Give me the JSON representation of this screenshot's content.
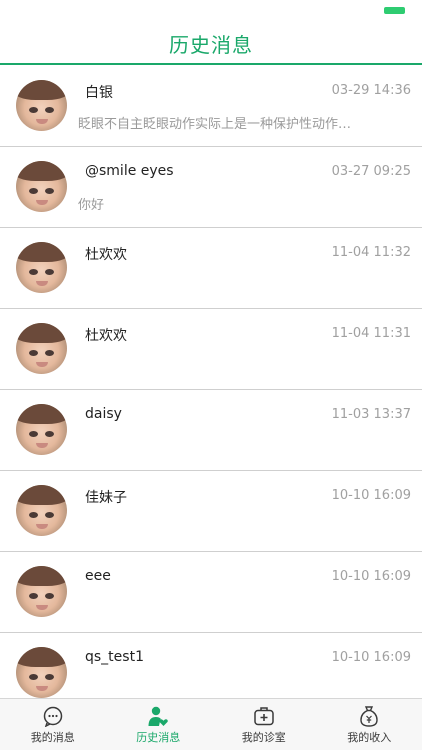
{
  "colors": {
    "accent": "#1aa86a",
    "battery": "#2ecc71",
    "tab_inactive": "#3a3a3a",
    "tab_active": "#1aa86a"
  },
  "header": {
    "title": "历史消息"
  },
  "messages": [
    {
      "name": "白银",
      "time": "03-29 14:36",
      "preview": "眨眼不自主眨眼动作实际上是一种保护性动作，..."
    },
    {
      "name": "@smile eyes",
      "time": "03-27 09:25",
      "preview": "你好"
    },
    {
      "name": "杜欢欢",
      "time": "11-04 11:32",
      "preview": ""
    },
    {
      "name": "杜欢欢",
      "time": "11-04 11:31",
      "preview": ""
    },
    {
      "name": "daisy",
      "time": "11-03 13:37",
      "preview": ""
    },
    {
      "name": "佳妹子",
      "time": "10-10 16:09",
      "preview": ""
    },
    {
      "name": "eee",
      "time": "10-10 16:09",
      "preview": ""
    },
    {
      "name": "qs_test1",
      "time": "10-10 16:09",
      "preview": ""
    }
  ],
  "tabs": [
    {
      "label": "我的消息",
      "icon": "chat-bubble-icon",
      "active": false
    },
    {
      "label": "历史消息",
      "icon": "person-heart-icon",
      "active": true
    },
    {
      "label": "我的诊室",
      "icon": "medical-kit-icon",
      "active": false
    },
    {
      "label": "我的收入",
      "icon": "money-bag-icon",
      "active": false
    }
  ]
}
